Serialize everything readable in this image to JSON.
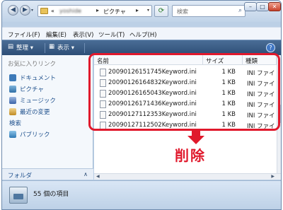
{
  "window": {
    "controls": {
      "minimize": "–",
      "maximize": "□",
      "close": "✕"
    }
  },
  "address": {
    "prefix": "«",
    "crumbs": [
      "yoshide",
      "ピクチャ"
    ],
    "separator": "▸",
    "dropdown": "▾"
  },
  "search": {
    "placeholder": "検索",
    "icon": "magnifier-icon"
  },
  "menu": {
    "items": [
      "ファイル(F)",
      "編集(E)",
      "表示(V)",
      "ツール(T)",
      "ヘルプ(H)"
    ]
  },
  "toolbar": {
    "organize": "整理 ▾",
    "view": "表示 ▾",
    "help": "?"
  },
  "sidebar": {
    "title": "お気に入りリンク",
    "items": [
      {
        "label": "ドキュメント",
        "icon": "documents-icon"
      },
      {
        "label": "ピクチャ",
        "icon": "pictures-icon"
      },
      {
        "label": "ミュージック",
        "icon": "music-icon"
      },
      {
        "label": "最近の変更",
        "icon": "recent-icon"
      },
      {
        "label": "検索",
        "icon": "search-folder-icon"
      },
      {
        "label": "パブリック",
        "icon": "public-icon"
      }
    ],
    "folders_label": "フォルダ",
    "folders_chevron": "∧"
  },
  "files": {
    "columns": [
      "名前",
      "サイズ",
      "種類"
    ],
    "rows": [
      {
        "name": "20090126151745Keyword.ini",
        "size": "1 KB",
        "type": "INI ファイ"
      },
      {
        "name": "20090126164832Keyword.ini",
        "size": "1 KB",
        "type": "INI ファイ"
      },
      {
        "name": "20090126165043Keyword.ini",
        "size": "1 KB",
        "type": "INI ファイ"
      },
      {
        "name": "20090126171436Keyword.ini",
        "size": "1 KB",
        "type": "INI ファイ"
      },
      {
        "name": "20090127112353Keyword.ini",
        "size": "1 KB",
        "type": "INI ファイ"
      },
      {
        "name": "20090127112502Keyword.ini",
        "size": "1 KB",
        "type": "INI ファイ"
      }
    ]
  },
  "annotation": {
    "label": "削除",
    "color": "#e0192c"
  },
  "status": {
    "text": "55 個の項目"
  }
}
